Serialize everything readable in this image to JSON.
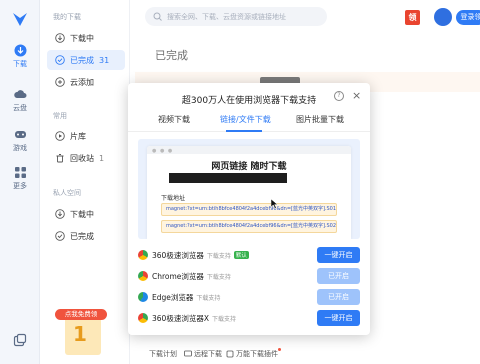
{
  "rail": {
    "items": [
      {
        "label": "下载",
        "active": true
      },
      {
        "label": "云盘",
        "active": false
      },
      {
        "label": "游戏",
        "active": false
      },
      {
        "label": "更多",
        "active": false
      }
    ]
  },
  "sidebar": {
    "section_my": "我的下载",
    "my_items": [
      {
        "label": "下载中",
        "count": ""
      },
      {
        "label": "已完成",
        "count": "31"
      },
      {
        "label": "云添加",
        "count": ""
      }
    ],
    "section_common": "常用",
    "common_items": [
      {
        "label": "片库",
        "count": ""
      },
      {
        "label": "回收站",
        "count": "1"
      }
    ],
    "section_private": "私人空间",
    "private_items": [
      {
        "label": "下载中",
        "count": ""
      },
      {
        "label": "已完成",
        "count": ""
      }
    ]
  },
  "topbar": {
    "search_placeholder": "搜索全网、下载、云盘资源或链接地址",
    "hot_badge": "领",
    "login": "登录领"
  },
  "main": {
    "title": "已完成"
  },
  "dialog": {
    "title": "超300万人在使用浏览器下载支持",
    "help": "?",
    "close": "×",
    "tabs": [
      "视频下载",
      "链接/文件下载",
      "图片批量下载"
    ],
    "active_tab": 1,
    "preview": {
      "heading": "网页链接 随时下载",
      "label": "下载地址",
      "links": [
        "magnet:?xt=urn:btih8bfce4804f2a4dcebf96&dn=[蓝光中英双字].S01.mp4",
        "magnet:?xt=urn:btih8bfce4804f2a4dcebf96&dn=[蓝光中英双字].S02.mp4"
      ]
    },
    "browsers": [
      {
        "name": "360极速浏览器",
        "sub": "下载支持",
        "tag": "默认",
        "button": "一键开启",
        "enabled": true,
        "color": "#35a853"
      },
      {
        "name": "Chrome浏览器",
        "sub": "下载支持",
        "tag": "",
        "button": "已开启",
        "enabled": false,
        "color": "#ea4335"
      },
      {
        "name": "Edge浏览器",
        "sub": "下载支持",
        "tag": "",
        "button": "已开启",
        "enabled": false,
        "color": "#1e88e5"
      },
      {
        "name": "360极速浏览器X",
        "sub": "下载支持",
        "tag": "",
        "button": "一键开启",
        "enabled": true,
        "color": "#35a853"
      }
    ]
  },
  "coupon": {
    "ribbon": "点我免费领",
    "number": "1"
  },
  "bottombar": {
    "items": [
      "下载计划",
      "远程下载",
      "万能下载插件"
    ]
  },
  "colors": {
    "accent": "#2f7bf5",
    "accent_light": "#9ec3fb",
    "hot": "#e9442f"
  }
}
